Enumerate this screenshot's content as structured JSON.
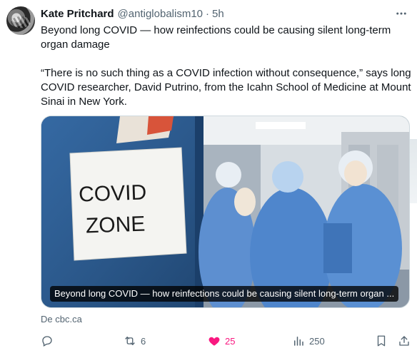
{
  "author": {
    "name": "Kate Pritchard",
    "handle": "@antiglobalism10",
    "separator": "·",
    "timestamp": "5h"
  },
  "tweet": {
    "paragraph1": "Beyond long COVID — how reinfections could be causing silent long-term organ damage",
    "paragraph2": "“There is no such thing as a COVID infection without consequence,” says long COVID researcher, David Putrino, from the Icahn School of Medicine at Mount Sinai in New York."
  },
  "media": {
    "sign_line1": "COVID",
    "sign_line2": "ZONE",
    "caption": "Beyond long COVID — how reinfections could be causing silent long-term organ ..."
  },
  "source": {
    "prefix": "De",
    "domain": "cbc.ca"
  },
  "actions": {
    "retweets": "6",
    "likes": "25",
    "views": "250"
  },
  "colors": {
    "text": "#0f1419",
    "muted": "#536471",
    "like": "#f91880",
    "border": "#cfd9de"
  },
  "icons": [
    "more-icon",
    "reply-icon",
    "retweet-icon",
    "heart-icon",
    "views-icon",
    "bookmark-icon",
    "share-icon"
  ]
}
